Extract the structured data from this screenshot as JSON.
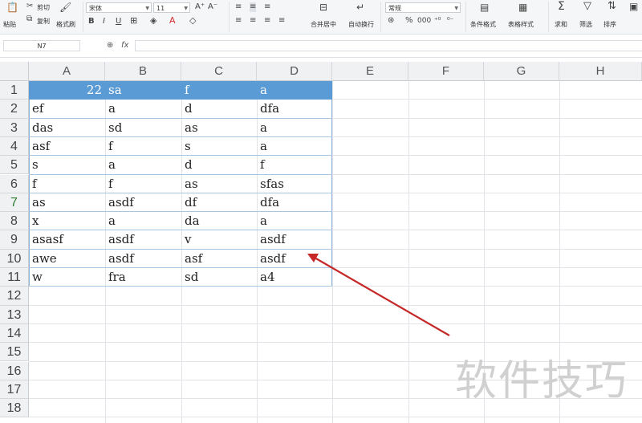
{
  "ribbon": {
    "paste_label": "粘贴",
    "cut_label": "剪切",
    "copy_label": "复制",
    "format_painter_label": "格式刷",
    "font_name": "宋体",
    "font_size": "11",
    "merge_center_label": "合并居中",
    "wrap_text_label": "自动换行",
    "number_format": "常规",
    "conditional_format_label": "条件格式",
    "table_style_label": "表格样式",
    "sum_label": "求和",
    "filter_label": "筛选",
    "sort_label": "排序"
  },
  "formula_bar": {
    "name_box": "N7",
    "fx_label": "fx",
    "formula": ""
  },
  "sheet": {
    "columns": [
      "A",
      "B",
      "C",
      "D",
      "E",
      "F",
      "G",
      "H"
    ],
    "rows": [
      "1",
      "2",
      "3",
      "4",
      "5",
      "6",
      "7",
      "8",
      "9",
      "10",
      "11",
      "12",
      "13",
      "14",
      "15",
      "16",
      "17",
      "18"
    ],
    "selected_row": "7",
    "header_row": [
      "22",
      "sa",
      "f",
      "a"
    ],
    "data": [
      [
        "ef",
        "a",
        "d",
        "dfa"
      ],
      [
        "das",
        "sd",
        "as",
        "a"
      ],
      [
        "asf",
        "f",
        "s",
        "a"
      ],
      [
        "s",
        "a",
        "d",
        "f"
      ],
      [
        "f",
        "f",
        "as",
        "sfas"
      ],
      [
        "as",
        "asdf",
        "df",
        "dfa"
      ],
      [
        "x",
        "a",
        "da",
        "a"
      ],
      [
        "asasf",
        "asdf",
        "v",
        "asdf"
      ],
      [
        "awe",
        "asdf",
        "asf",
        "asdf"
      ],
      [
        "w",
        "fra",
        "sd",
        "a4"
      ]
    ],
    "header_color": "#5b9bd5",
    "border_color": "#8eb4da"
  },
  "annotation": {
    "arrow_color": "#c62828"
  },
  "watermark": "软件技巧"
}
